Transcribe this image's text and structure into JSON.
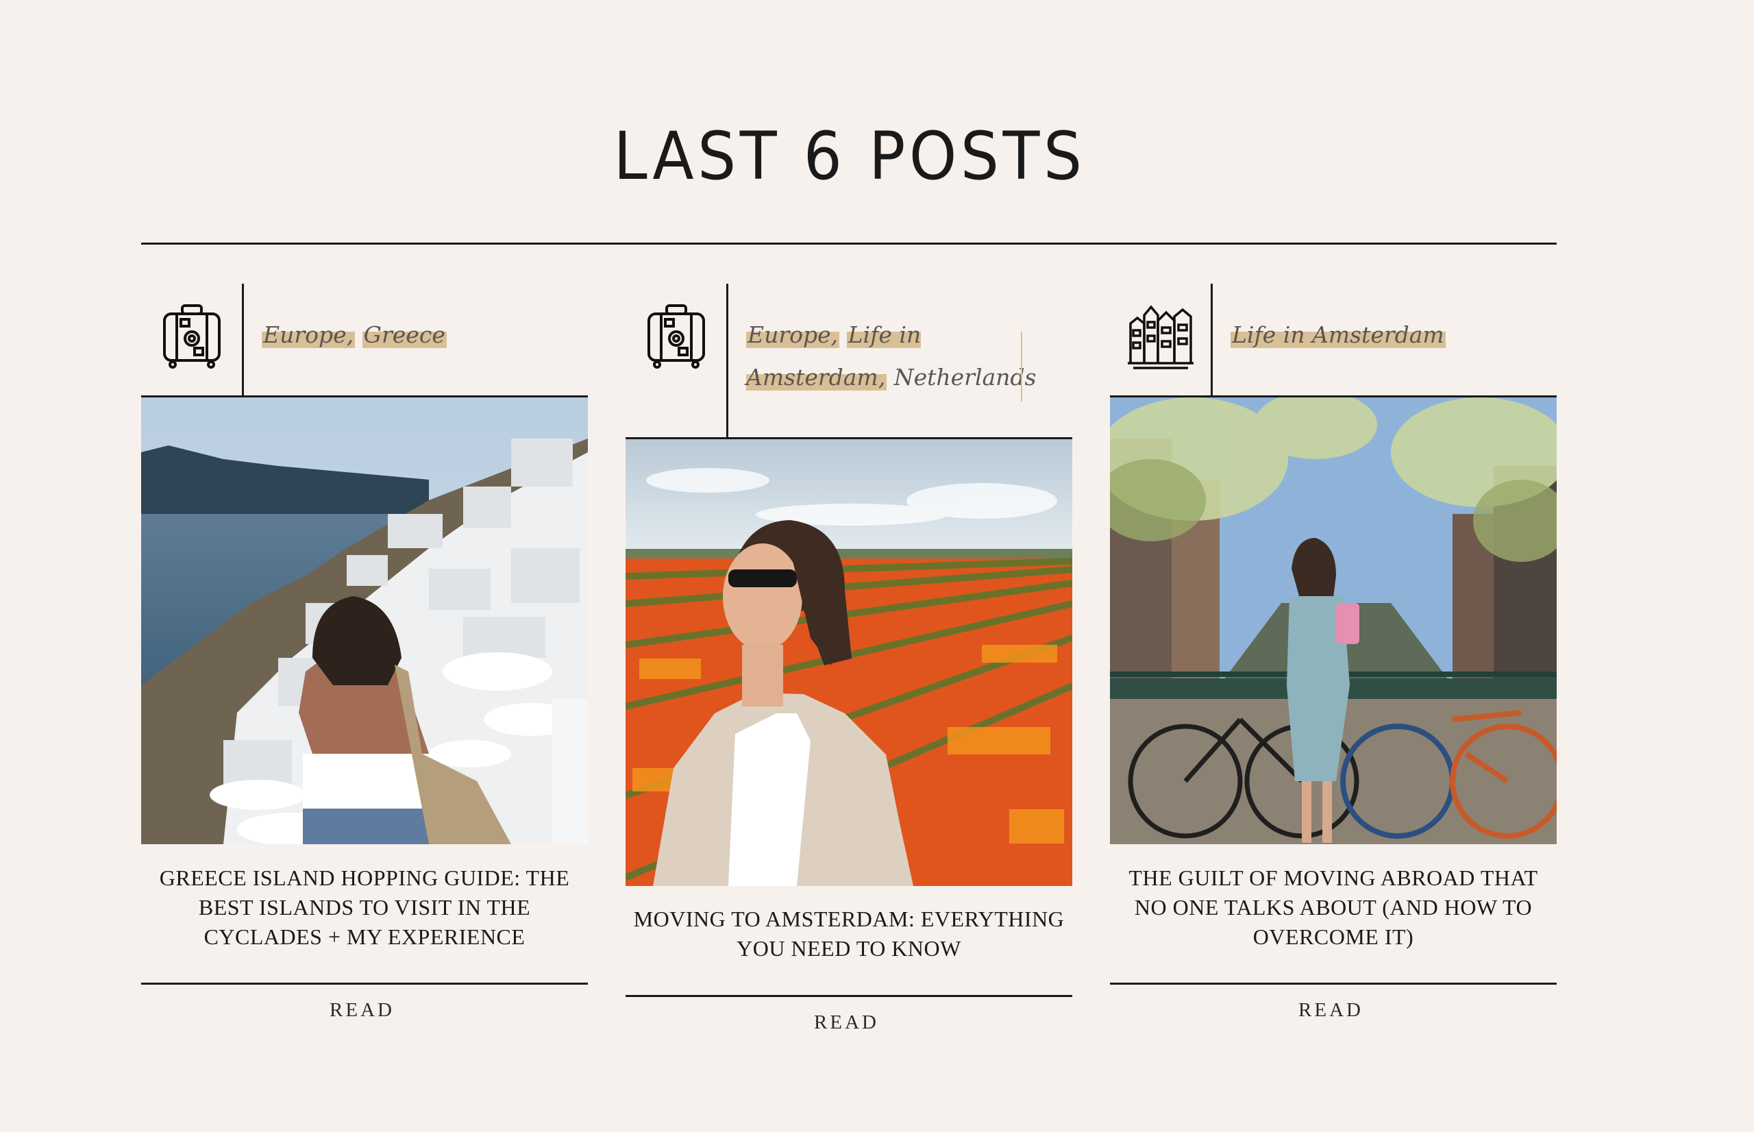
{
  "section": {
    "title": "LAST 6 POSTS"
  },
  "posts": [
    {
      "icon": "suitcase-icon",
      "tags": [
        "Europe,",
        "Greece"
      ],
      "title": "GREECE ISLAND HOPPING GUIDE: THE BEST ISLANDS TO VISIT IN THE CYCLADES + MY EXPERIENCE",
      "read_label": "READ",
      "image": "Woman in white top overlooking whitewashed cliffside village and sea in Santorini"
    },
    {
      "icon": "suitcase-icon",
      "tags": [
        "Europe,",
        "Life in Amsterdam,",
        "Netherlands"
      ],
      "title": "MOVING TO AMSTERDAM: EVERYTHING YOU NEED TO KNOW",
      "read_label": "READ",
      "image": "Woman in beige coat smiling in front of an orange tulip field"
    },
    {
      "icon": "canal-houses-icon",
      "tags": [
        "Life in Amsterdam"
      ],
      "title": "THE GUILT OF MOVING ABROAD THAT NO ONE TALKS ABOUT (AND HOW TO OVERCOME IT)",
      "read_label": "READ",
      "image": "Woman standing on a canal bridge with bicycles in Amsterdam"
    }
  ],
  "colors": {
    "background": "#f7f1ee",
    "ink": "#1a1a1a",
    "tag_highlight": "#d9bf96",
    "tag_text": "#5c5652"
  }
}
